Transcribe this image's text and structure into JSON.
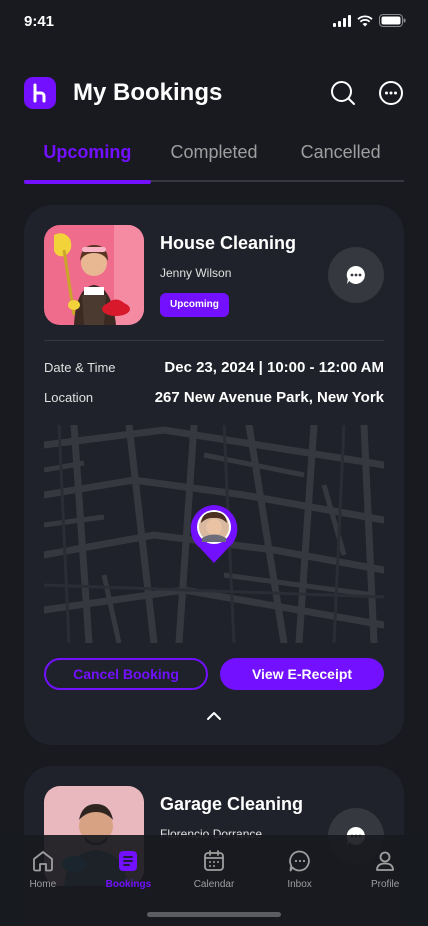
{
  "status_bar": {
    "time": "9:41"
  },
  "header": {
    "title": "My Bookings",
    "search_icon": "search-icon",
    "more_icon": "more-icon"
  },
  "tabs": [
    {
      "label": "Upcoming",
      "active": true
    },
    {
      "label": "Completed",
      "active": false
    },
    {
      "label": "Cancelled",
      "active": false
    }
  ],
  "bookings": [
    {
      "title": "House Cleaning",
      "provider": "Jenny Wilson",
      "status": "Upcoming",
      "date_label": "Date & Time",
      "date_value": "Dec 23, 2024 | 10:00 - 12:00 AM",
      "location_label": "Location",
      "location_value": "267 New Avenue Park, New York",
      "cancel_label": "Cancel Booking",
      "receipt_label": "View E-Receipt"
    },
    {
      "title": "Garage Cleaning",
      "provider": "Florencio Dorrance"
    }
  ],
  "bottom_nav": [
    {
      "label": "Home",
      "icon": "home-icon",
      "active": false
    },
    {
      "label": "Bookings",
      "icon": "bookings-icon",
      "active": true
    },
    {
      "label": "Calendar",
      "icon": "calendar-icon",
      "active": false
    },
    {
      "label": "Inbox",
      "icon": "inbox-icon",
      "active": false
    },
    {
      "label": "Profile",
      "icon": "profile-icon",
      "active": false
    }
  ],
  "colors": {
    "accent": "#7210FF",
    "background": "#181A20",
    "card": "#1F222A",
    "muted": "#9E9E9E"
  }
}
